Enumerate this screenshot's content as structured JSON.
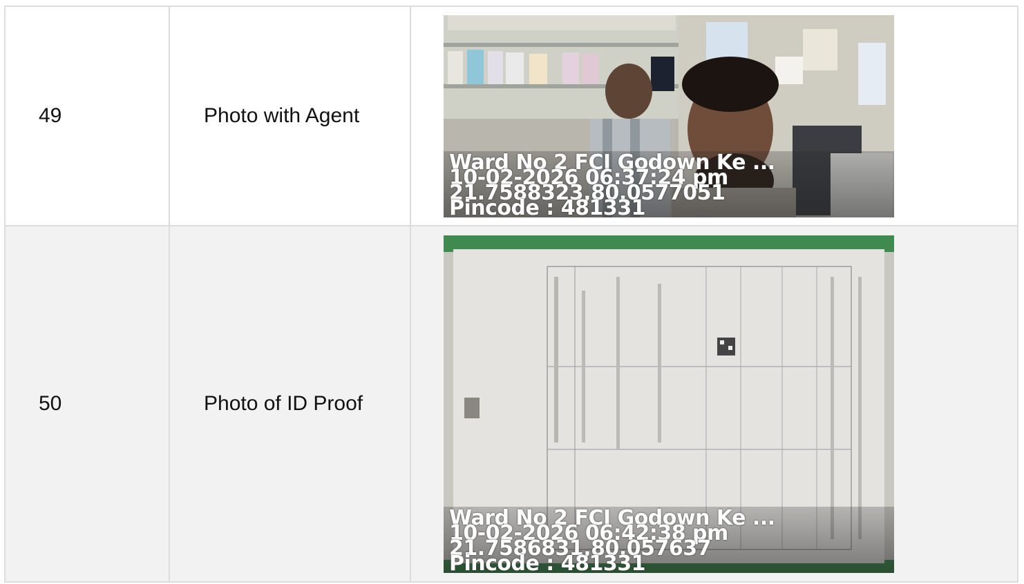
{
  "rows": [
    {
      "number": "49",
      "label": "Photo with Agent",
      "photo": {
        "stamp_address": "Ward No 2 FCI Godown Ke ...",
        "stamp_datetime": "10-02-2026 06:37:24 pm",
        "stamp_coords": "21.7588323,80.0577051",
        "stamp_pincode": "Pincode : 481331"
      }
    },
    {
      "number": "50",
      "label": "Photo of ID Proof",
      "photo": {
        "stamp_address": "Ward No 2 FCI Godown Ke ...",
        "stamp_datetime": "10-02-2026 06:42:38 pm",
        "stamp_coords": "21.7586831,80.057637",
        "stamp_pincode": "Pincode : 481331"
      }
    }
  ],
  "colors": {
    "border": "#dcdcdc",
    "alt_row": "#f2f2f2",
    "text": "#111111"
  }
}
